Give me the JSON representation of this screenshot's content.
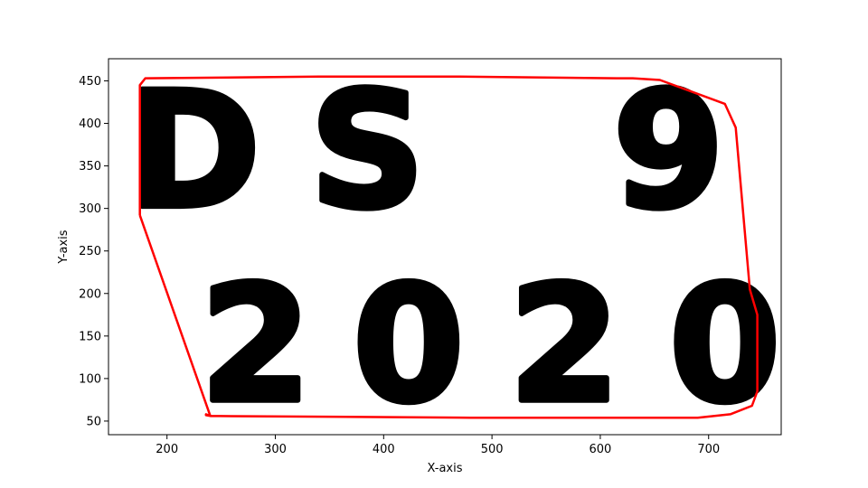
{
  "chart_data": {
    "type": "scatter",
    "title": "",
    "xlabel": "X-axis",
    "ylabel": "Y-axis",
    "xlim": [
      146,
      767
    ],
    "ylim": [
      34,
      476
    ],
    "xticks": [
      200,
      300,
      400,
      500,
      600,
      700
    ],
    "yticks": [
      50,
      100,
      150,
      200,
      250,
      300,
      350,
      400,
      450
    ],
    "grid": false,
    "legend": "none",
    "series": [
      {
        "kind": "scatter-glyphs",
        "color": "#000000",
        "glyphs": [
          {
            "char": "D",
            "x_center": 225,
            "y_center": 368
          },
          {
            "char": "S",
            "x_center": 385,
            "y_center": 368
          },
          {
            "char": "9",
            "x_center": 663,
            "y_center": 368
          },
          {
            "char": "2",
            "x_center": 282,
            "y_center": 140
          },
          {
            "char": "0",
            "x_center": 423,
            "y_center": 140
          },
          {
            "char": "2",
            "x_center": 567,
            "y_center": 140
          },
          {
            "char": "0",
            "x_center": 715,
            "y_center": 140
          }
        ]
      },
      {
        "kind": "line",
        "color": "#ff0000",
        "x": [
          175,
          175,
          180,
          340,
          412,
          470,
          615,
          630,
          655,
          715,
          725,
          738,
          745,
          745,
          740,
          720,
          690,
          480,
          240,
          236,
          236,
          240,
          175
        ],
        "y": [
          292,
          445,
          453,
          455,
          455,
          455,
          453,
          453,
          451,
          423,
          395,
          205,
          175,
          85,
          68,
          58,
          54,
          54,
          56,
          58,
          57,
          56,
          292
        ]
      }
    ]
  }
}
